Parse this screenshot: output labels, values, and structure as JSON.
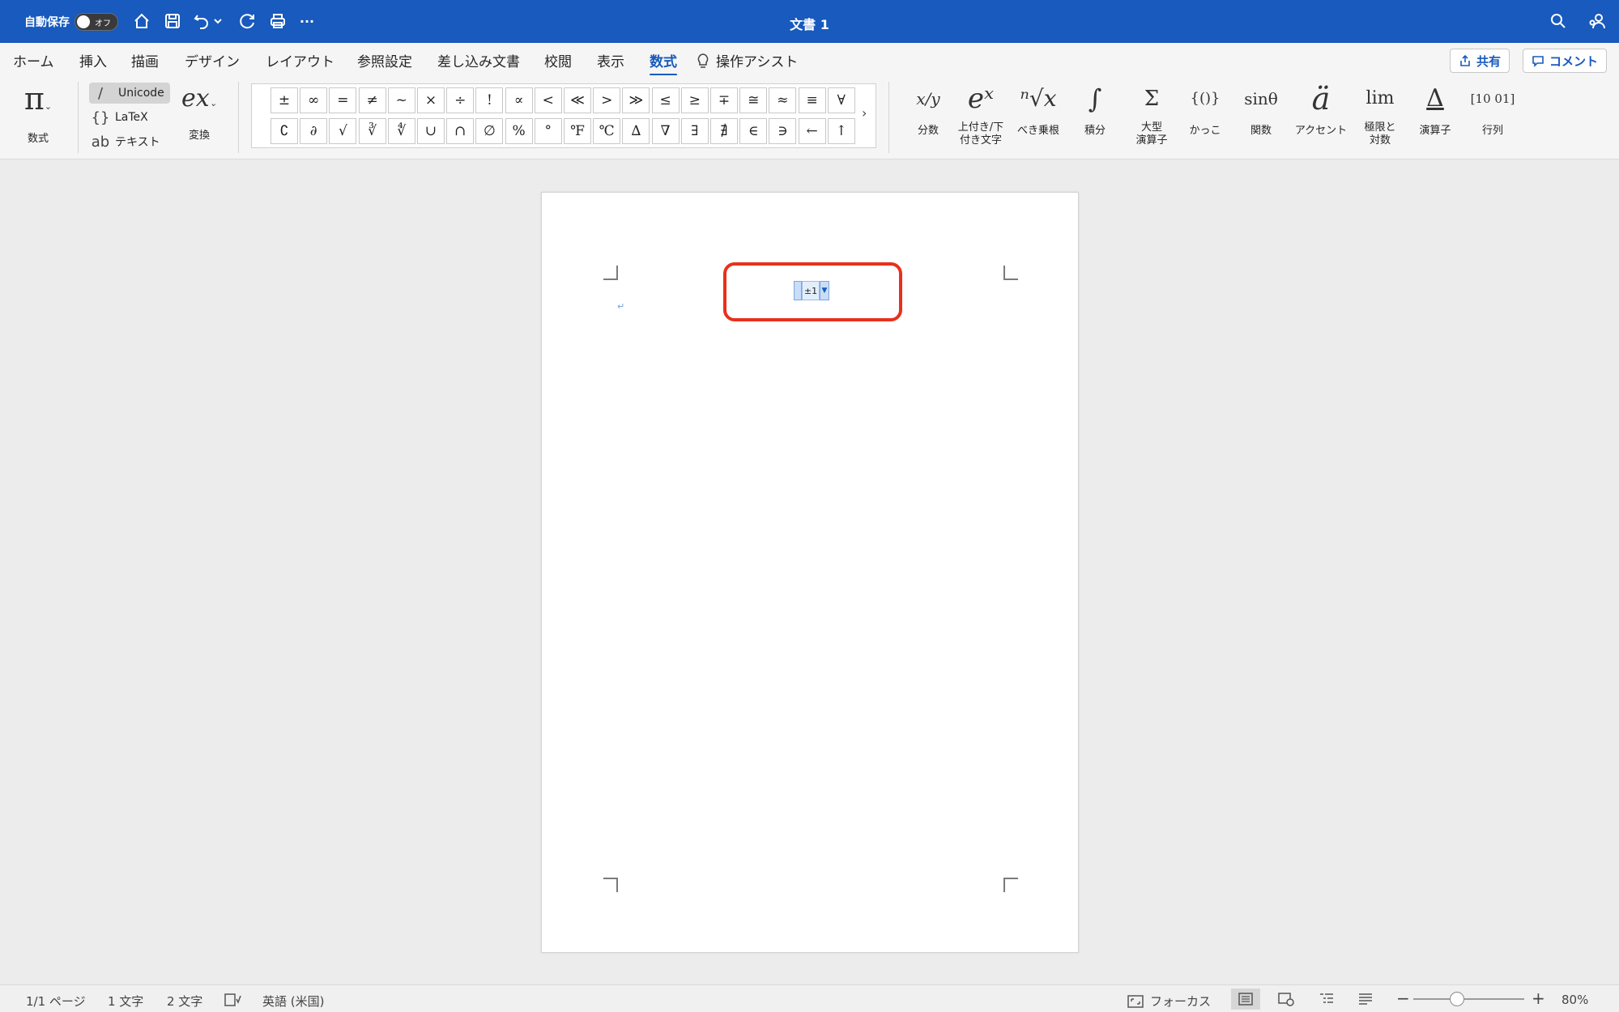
{
  "titlebar": {
    "autosave_label": "自動保存",
    "autosave_state": "オフ",
    "document_title": "文書 1",
    "more_label": "···"
  },
  "tabs": [
    {
      "label": "ホーム"
    },
    {
      "label": "挿入"
    },
    {
      "label": "描画"
    },
    {
      "label": "デザイン"
    },
    {
      "label": "レイアウト"
    },
    {
      "label": "参照設定"
    },
    {
      "label": "差し込み文書"
    },
    {
      "label": "校閲"
    },
    {
      "label": "表示"
    },
    {
      "label": "数式"
    },
    {
      "label": "操作アシスト"
    }
  ],
  "actions": {
    "share_label": "共有",
    "comment_label": "コメント"
  },
  "ribbon": {
    "equation_label": "数式",
    "modes": [
      {
        "icon": "/",
        "label": "Unicode"
      },
      {
        "icon": "{}",
        "label": "LaTeX"
      },
      {
        "icon": "ab",
        "label": "テキスト"
      }
    ],
    "convert_label": "変換",
    "symbols_row1": [
      "±",
      "∞",
      "=",
      "≠",
      "~",
      "×",
      "÷",
      "!",
      "∝",
      "<",
      "≪",
      ">",
      "≫",
      "≤",
      "≥",
      "∓",
      "≅",
      "≈",
      "≡",
      "∀"
    ],
    "symbols_row2": [
      "∁",
      "∂",
      "√",
      "∛",
      "∜",
      "∪",
      "∩",
      "∅",
      "%",
      "°",
      "℉",
      "℃",
      "∆",
      "∇",
      "∃",
      "∄",
      "∈",
      "∋",
      "←",
      "↑"
    ],
    "gallery_more": "›",
    "structures": [
      {
        "glyph": "x/y",
        "label": "分数",
        "label2": ""
      },
      {
        "glyph": "eˣ",
        "label": "上付き/下",
        "label2": "付き文字"
      },
      {
        "glyph": "ⁿ√x",
        "label": "べき乗根",
        "label2": ""
      },
      {
        "glyph": "∫",
        "label": "積分",
        "label2": ""
      },
      {
        "glyph": "Σ",
        "label": "大型",
        "label2": "演算子"
      },
      {
        "glyph": "{()}",
        "label": "かっこ",
        "label2": ""
      },
      {
        "glyph": "sinθ",
        "label": "関数",
        "label2": ""
      },
      {
        "glyph": "ä",
        "label": "アクセント",
        "label2": ""
      },
      {
        "glyph": "lim",
        "label": "極限と",
        "label2": "対数"
      },
      {
        "glyph": "Δ",
        "label": "演算子",
        "label2": ""
      },
      {
        "glyph": "[10 01]",
        "label": "行列",
        "label2": ""
      }
    ]
  },
  "document": {
    "equation_content": "±1",
    "equation_dropdown": "▼",
    "paragraph_mark": "↵"
  },
  "statusbar": {
    "page": "1/1 ページ",
    "words": "1 文字",
    "chars": "2 文字",
    "language": "英語 (米国)",
    "focus": "フォーカス",
    "zoom_minus": "−",
    "zoom_plus": "+",
    "zoom": "80%",
    "zoom_level_percent": 80
  },
  "colors": {
    "accent": "#185abd",
    "highlight": "#e8301b"
  }
}
